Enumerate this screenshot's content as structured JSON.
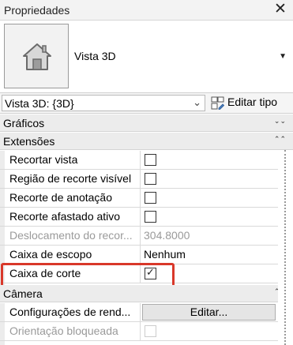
{
  "window": {
    "title": "Propriedades"
  },
  "type_selector": {
    "name": "Vista 3D",
    "icon": "house-icon"
  },
  "view_selector": {
    "value": "Vista 3D: {3D}"
  },
  "edit_type": {
    "label": "Editar tipo"
  },
  "sections": {
    "graficos": "Gráficos",
    "extensoes": "Extensões",
    "camera": "Câmera"
  },
  "properties": {
    "recortar_vista": {
      "label": "Recortar vista",
      "checked": false
    },
    "regiao_recorte": {
      "label": "Região de recorte visível",
      "checked": false
    },
    "recorte_anotacao": {
      "label": "Recorte de anotação",
      "checked": false
    },
    "recorte_afastado": {
      "label": "Recorte afastado ativo",
      "checked": false
    },
    "deslocamento": {
      "label": "Deslocamento do recor...",
      "value": "304.8000"
    },
    "caixa_escopo": {
      "label": "Caixa de escopo",
      "value": "Nenhum"
    },
    "caixa_corte": {
      "label": "Caixa de corte",
      "checked": true,
      "check_glyph": "✓"
    },
    "config_render": {
      "label": "Configurações de rend...",
      "button": "Editar..."
    },
    "orientacao": {
      "label": "Orientação bloqueada",
      "checked": false
    }
  },
  "colors": {
    "highlight": "#d9382a",
    "section_bg": "#ececec"
  }
}
